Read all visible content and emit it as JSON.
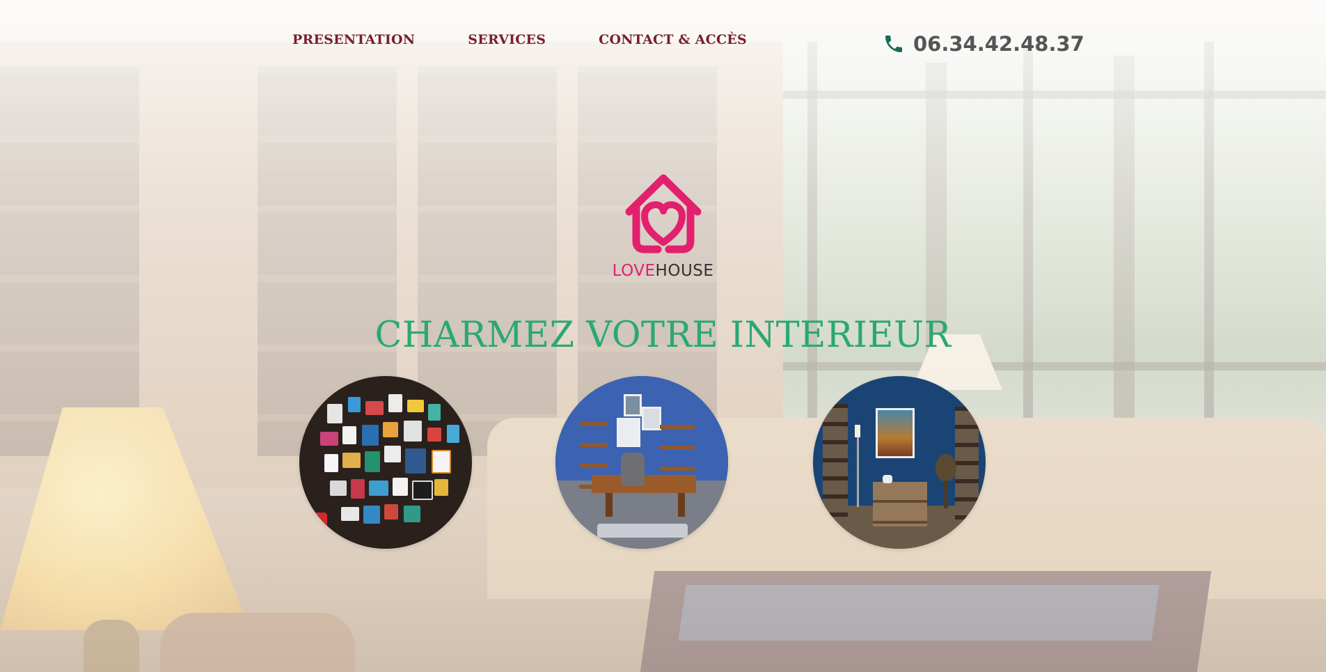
{
  "nav": {
    "items": [
      {
        "label": "PRESENTATION"
      },
      {
        "label": "SERVICES"
      },
      {
        "label": "CONTACT & ACCÈS"
      }
    ]
  },
  "phone": {
    "icon": "phone-icon",
    "number": "06.34.42.48.37"
  },
  "brand": {
    "love": "LOVE",
    "house": "HOUSE",
    "logo_icon": "heart-house-icon"
  },
  "hero": {
    "headline": "CHARMEZ VOTRE INTERIEUR"
  },
  "colors": {
    "nav_text": "#7a1f2a",
    "accent_pink": "#e3206d",
    "headline_green": "#2aa874",
    "phone_icon": "#1c6b57",
    "phone_text": "#555556"
  },
  "gallery": [
    {
      "name": "wall-of-posters-image"
    },
    {
      "name": "blue-office-image"
    },
    {
      "name": "blue-living-room-image"
    }
  ]
}
